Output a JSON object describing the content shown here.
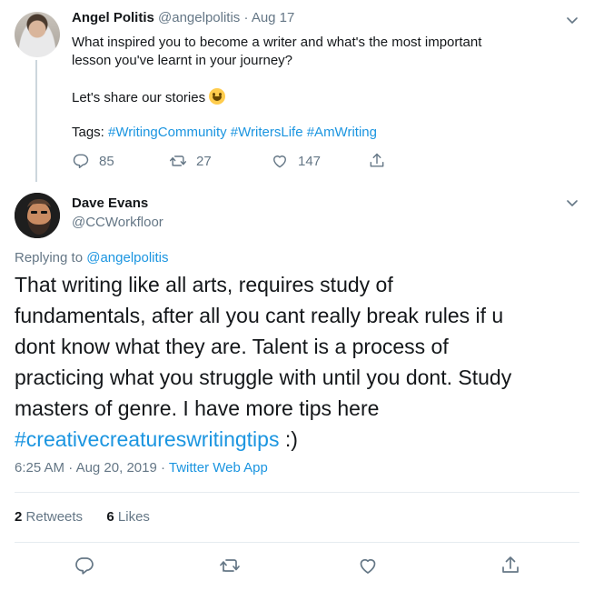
{
  "parent_tweet": {
    "name": "Angel Politis",
    "handle": "@angelpolitis",
    "separator": "·",
    "date": "Aug 17",
    "text_line1": "What inspired you to become a writer and what's the most important",
    "text_line2": "lesson you've learnt in your journey?",
    "text_line3": "Let's share our stories",
    "tags_label": "Tags:",
    "tags": [
      "#WritingCommunity",
      "#WritersLife",
      "#AmWriting"
    ],
    "replies": "85",
    "retweets": "27",
    "likes": "147",
    "icons": {
      "reply": "reply-icon",
      "retweet": "retweet-icon",
      "like": "heart-icon",
      "share": "share-icon",
      "menu": "chevron-down-icon",
      "emoji": "grinning-face-emoji"
    }
  },
  "focused_tweet": {
    "name": "Dave Evans",
    "handle": "@CCWorkfloor",
    "replying_to_label": "Replying to",
    "replying_to_handle": "@angelpolitis",
    "body_line1": "That writing like all arts, requires study of",
    "body_line2": "fundamentals, after all you cant really break rules if u",
    "body_line3": "dont know what they are. Talent is a process of",
    "body_line4": "practicing what you struggle with until you dont. Study",
    "body_line5": "masters of genre. I have more tips here",
    "body_hashtag": "#creativecreatureswritingtips",
    "body_tail": ":)",
    "time": "6:25 AM",
    "separator": "·",
    "date": "Aug 20, 2019",
    "source": "Twitter Web App",
    "retweet_count": "2",
    "retweet_label": "Retweets",
    "like_count": "6",
    "like_label": "Likes"
  },
  "colors": {
    "accent": "#1b95e0",
    "text": "#14171a",
    "muted": "#657786",
    "divider": "#e6ecf0",
    "thread_line": "#ccd6dd"
  }
}
